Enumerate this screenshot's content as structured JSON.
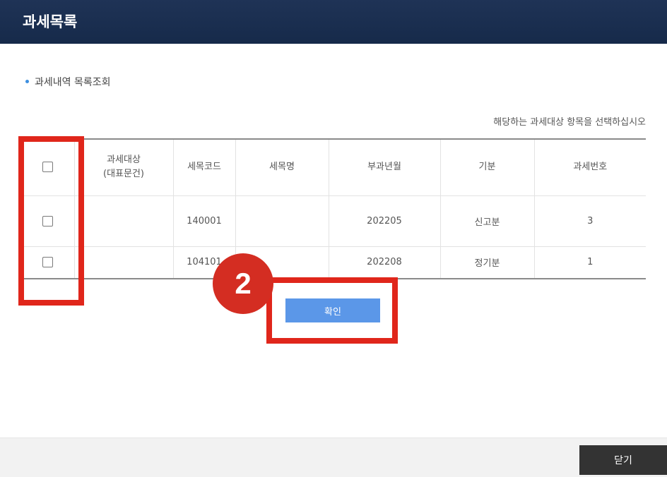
{
  "window": {
    "title": "과세목록"
  },
  "section": {
    "title": "과세내역 목록조회"
  },
  "instruction": "해당하는 과세대상 항목을 선택하십시오",
  "table": {
    "headers": {
      "target_line1": "과세대상",
      "target_line2": "(대표문건)",
      "tax_code": "세목코드",
      "tax_name": "세목명",
      "period": "부과년월",
      "period_type": "기분",
      "tax_number": "과세번호"
    },
    "rows": [
      {
        "target": "",
        "tax_code": "140001",
        "tax_name": "",
        "period": "202205",
        "period_type": "신고분",
        "tax_number": "3"
      },
      {
        "target": "",
        "tax_code": "104101",
        "tax_name": "",
        "period": "202208",
        "period_type": "정기분",
        "tax_number": "1"
      }
    ]
  },
  "annotation": {
    "step": "2"
  },
  "buttons": {
    "confirm": "확인",
    "close": "닫기"
  },
  "colors": {
    "titlebar": "#1f3356",
    "highlight": "#e0261b",
    "confirm": "#5b97e8",
    "close": "#333333"
  }
}
